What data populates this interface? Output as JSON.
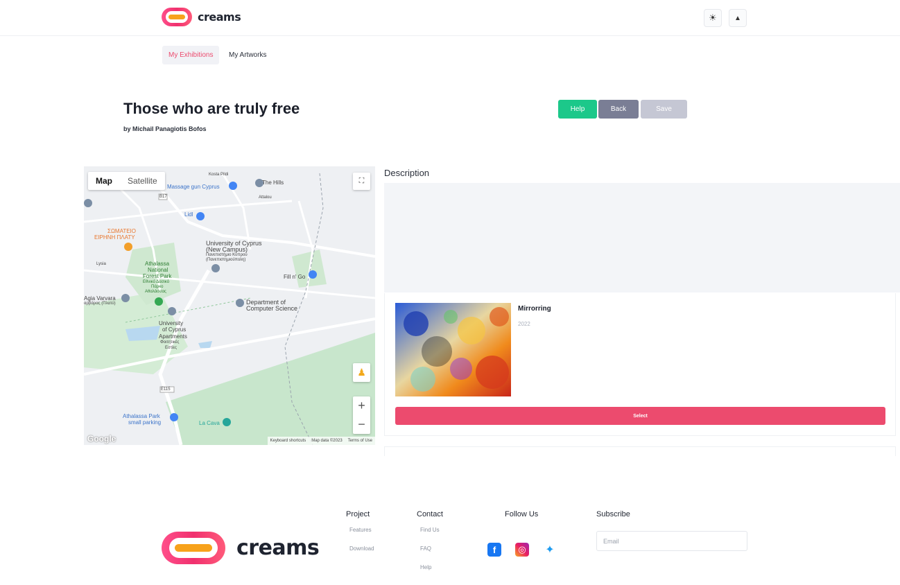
{
  "header": {
    "logo_text": "creams",
    "theme_icon": "sun-icon",
    "user_icon": "user-icon"
  },
  "tabs": [
    {
      "label": "My Exhibitions",
      "active": true
    },
    {
      "label": "My Artworks",
      "active": false
    }
  ],
  "exhibition": {
    "title": "Those who are truly free",
    "byline": "by Michail Panagiotis Bofos"
  },
  "actions": {
    "help": "Help",
    "back": "Back",
    "save": "Save"
  },
  "map": {
    "type_map": "Map",
    "type_satellite": "Satellite",
    "labels": {
      "koota": "Kosta Pildi",
      "massage": "Massage gun Cyprus",
      "hills": "The Hills",
      "attalou": "Attalou",
      "lidl": "Lidl",
      "somateio1": "ΣΩΜΑΤΕΙΟ",
      "somateio2": "ΕΙΡΗΝΗ ΠΛΑΤΥ",
      "ucy1": "University of Cyprus",
      "ucy2": "(New Campus)",
      "ucy3": "Πανεπιστήμιο Κύπρου",
      "ucy4": "(Πανεπιστημιούπολη)",
      "park1": "Athalassa",
      "park2": "National",
      "park3": "Forest Park",
      "park4": "Εθνικό Δασικό",
      "park5": "Πάρκο",
      "park6": "Αθαλάσσας",
      "fillngo": "Fill n' Go",
      "agia1": "Agia Varvara",
      "agia2": "αρβάρας (Πλατύ)",
      "dcs1": "Department of",
      "dcs2": "Computer Science",
      "apts1": "University",
      "apts2": "of Cyprus",
      "apts3": "Apartments",
      "apts4": "Φοιτητικές",
      "apts5": "Εστίες",
      "lysia": "Lysia",
      "road": "E115",
      "road2": "B17",
      "parking1": "Athalassa Park",
      "parking2": "small parking",
      "lacava": "La Cava"
    },
    "google": "Google",
    "footer_shortcuts": "Keyboard shortcuts",
    "footer_data": "Map data ©2023",
    "footer_terms": "Terms of Use"
  },
  "description": {
    "heading": "Description"
  },
  "artwork": {
    "title": "Mirrorring",
    "year": "2022",
    "select_label": "Select"
  },
  "footer": {
    "logo_text": "creams",
    "project": {
      "heading": "Project",
      "links": [
        "Features",
        "Download"
      ]
    },
    "contact": {
      "heading": "Contact",
      "links": [
        "Find Us",
        "FAQ",
        "Help"
      ]
    },
    "follow": {
      "heading": "Follow Us"
    },
    "subscribe": {
      "heading": "Subscribe",
      "placeholder": "Email"
    }
  },
  "colors": {
    "accent": "#ec4b6e",
    "help_green": "#1cc88a",
    "back_gray": "#7a7e95",
    "save_disabled": "#c5c7d4"
  }
}
